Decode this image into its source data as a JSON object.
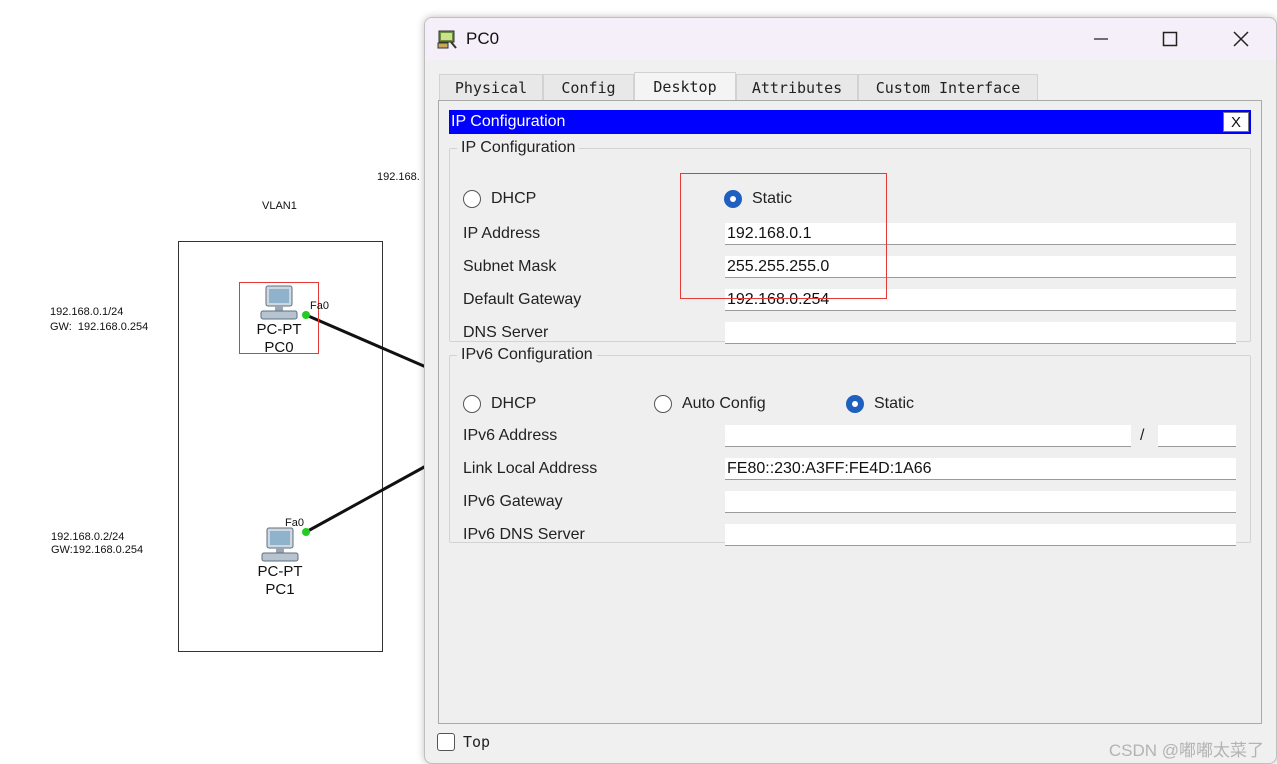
{
  "topology": {
    "top_ip_label": "192.168.",
    "vlan_label": "VLAN1",
    "pc0_ip_line1": "192.168.0.1/24",
    "pc0_ip_line2": "GW:  192.168.0.254",
    "pc1_ip_line1": "192.168.0.2/24",
    "pc1_ip_line2": "GW:192.168.0.254",
    "pc0_type": "PC-PT",
    "pc0_name": "PC0",
    "pc1_type": "PC-PT",
    "pc1_name": "PC1",
    "pc0_port": "Fa0",
    "pc1_port": "Fa0"
  },
  "window": {
    "title": "PC0",
    "minimize_icon": "minimize-icon",
    "maximize_icon": "maximize-icon",
    "close_icon": "close-icon"
  },
  "tabs": [
    "Physical",
    "Config",
    "Desktop",
    "Attributes",
    "Custom Interface"
  ],
  "active_tab": "Desktop",
  "ip_config": {
    "bar_title": "IP Configuration",
    "close_label": "X",
    "ipv4_group_title": "IP Configuration",
    "dhcp_label": "DHCP",
    "static_label": "Static",
    "mode": "Static",
    "ip_address_label": "IP Address",
    "ip_address": "192.168.0.1",
    "subnet_mask_label": "Subnet Mask",
    "subnet_mask": "255.255.255.0",
    "default_gateway_label": "Default Gateway",
    "default_gateway": "192.168.0.254",
    "dns_server_label": "DNS Server",
    "dns_server": "",
    "ipv6_group_title": "IPv6 Configuration",
    "ipv6_dhcp_label": "DHCP",
    "ipv6_auto_label": "Auto Config",
    "ipv6_static_label": "Static",
    "ipv6_mode": "Static",
    "ipv6_address_label": "IPv6 Address",
    "ipv6_address": "",
    "ipv6_prefix_sep": "/",
    "ipv6_prefix": "",
    "link_local_label": "Link Local Address",
    "link_local": "FE80::230:A3FF:FE4D:1A66",
    "ipv6_gateway_label": "IPv6 Gateway",
    "ipv6_gateway": "",
    "ipv6_dns_label": "IPv6 DNS Server",
    "ipv6_dns": ""
  },
  "footer": {
    "top_label": "Top",
    "top_checked": false,
    "watermark": "CSDN @嘟嘟太菜了"
  },
  "colors": {
    "ipc_bar": "#0000ff",
    "radio_selected": "#1f5fbf",
    "highlight_box": "#e53935",
    "link_dot": "#22cc22"
  }
}
